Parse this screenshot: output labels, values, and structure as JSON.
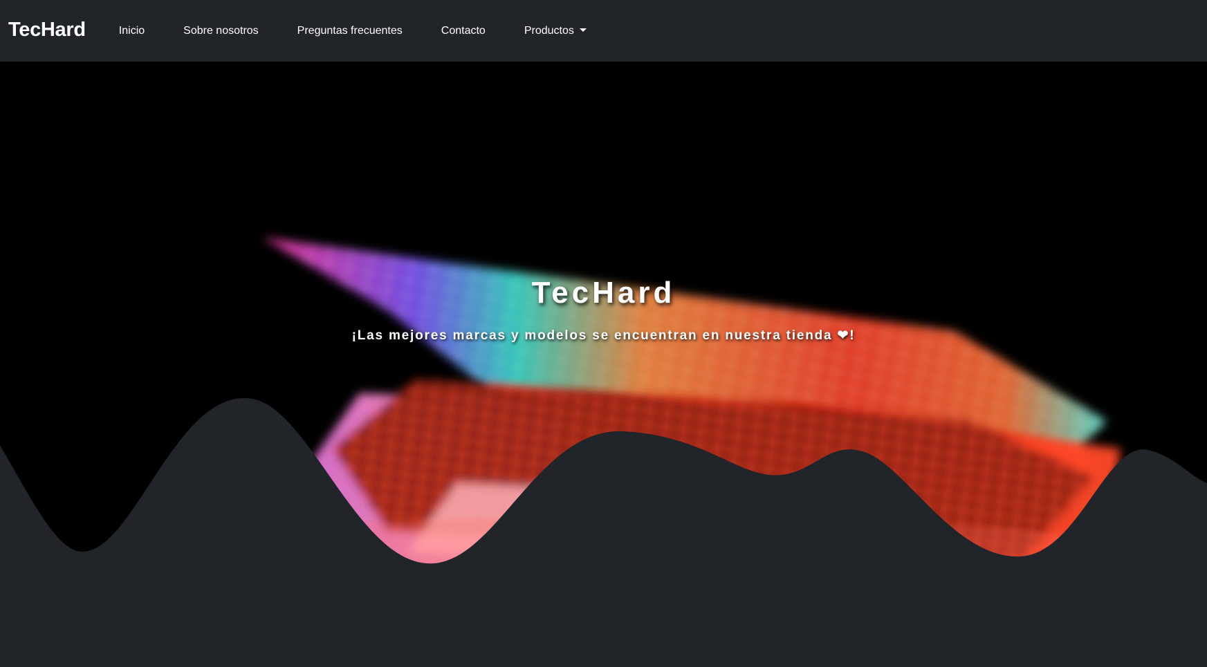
{
  "navbar": {
    "brand": "TecHard",
    "items": [
      {
        "label": "Inicio"
      },
      {
        "label": "Sobre nosotros"
      },
      {
        "label": "Preguntas frecuentes"
      },
      {
        "label": "Contacto"
      },
      {
        "label": "Productos",
        "dropdown": true
      }
    ]
  },
  "hero": {
    "title": "TecHard",
    "subtitle": "¡Las mejores marcas y modelos se encuentran en nuestra tienda ❤!"
  },
  "colors": {
    "navbar_bg": "#212529",
    "wave_fill": "#212529",
    "hero_bg": "#000000"
  }
}
